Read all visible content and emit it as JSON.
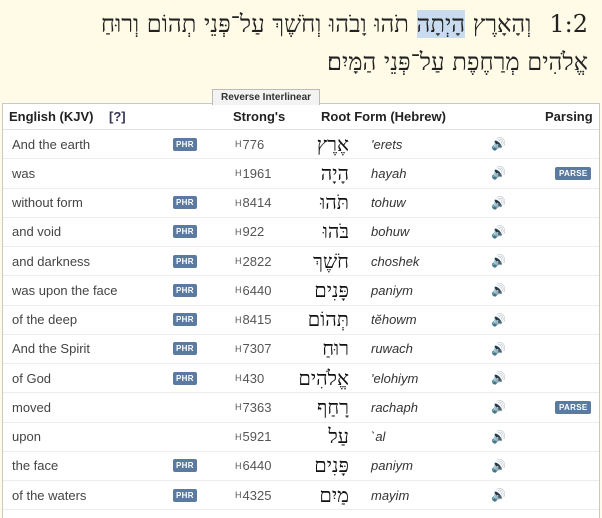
{
  "verse": {
    "reference": "1:2",
    "line1_before": "וְהָאָרֶץ ",
    "line1_highlight": "הָיְתָה",
    "line1_after": " תֹהוּ וָבֹהוּ וְחֹשֶׁךְ עַל־פְּנֵי תְהוֹם וְרוּחַ",
    "line2": "אֱלֹהִים מְרַחֶפֶת עַל־פְּנֵי הַמָּיִם׃"
  },
  "tab_label": "Reverse Interlinear",
  "header": {
    "english": "English (KJV)",
    "help": "[?]",
    "strongs": "Strong's",
    "root": "Root Form (Hebrew)",
    "parsing": "Parsing"
  },
  "badges": {
    "phrase": "PHR",
    "parse": "PARSE"
  },
  "speaker_icon_glyph": "🔊",
  "rows": [
    {
      "english": "And the earth",
      "phr": true,
      "strongs_prefix": "H",
      "strongs_num": "776",
      "hebrew": "אֶרֶץ",
      "translit": "'erets",
      "parse": false
    },
    {
      "english": "was",
      "phr": false,
      "strongs_prefix": "H",
      "strongs_num": "1961",
      "hebrew": "הָיָה",
      "translit": "hayah",
      "parse": true
    },
    {
      "english": "without form",
      "phr": true,
      "strongs_prefix": "H",
      "strongs_num": "8414",
      "hebrew": "תֹּהוּ",
      "translit": "tohuw",
      "parse": false
    },
    {
      "english": "and void",
      "phr": true,
      "strongs_prefix": "H",
      "strongs_num": "922",
      "hebrew": "בֹּהוּ",
      "translit": "bohuw",
      "parse": false
    },
    {
      "english": "and darkness",
      "phr": true,
      "strongs_prefix": "H",
      "strongs_num": "2822",
      "hebrew": "חֹשֶׁךְ",
      "translit": "choshek",
      "parse": false
    },
    {
      "english": "was upon the face",
      "phr": true,
      "strongs_prefix": "H",
      "strongs_num": "6440",
      "hebrew": "פָּנִים",
      "translit": "paniym",
      "parse": false
    },
    {
      "english": "of the deep",
      "phr": true,
      "strongs_prefix": "H",
      "strongs_num": "8415",
      "hebrew": "תְּהוֹם",
      "translit": "tĕhowm",
      "parse": false
    },
    {
      "english": "And the Spirit",
      "phr": true,
      "strongs_prefix": "H",
      "strongs_num": "7307",
      "hebrew": "רוּחַ",
      "translit": "ruwach",
      "parse": false
    },
    {
      "english": "of God",
      "phr": true,
      "strongs_prefix": "H",
      "strongs_num": "430",
      "hebrew": "אֱלֹהִים",
      "translit": "'elohiym",
      "parse": false
    },
    {
      "english": "moved",
      "phr": false,
      "strongs_prefix": "H",
      "strongs_num": "7363",
      "hebrew": "רָחַף",
      "translit": "rachaph",
      "parse": true
    },
    {
      "english": "upon",
      "phr": false,
      "strongs_prefix": "H",
      "strongs_num": "5921",
      "hebrew": "עַל",
      "translit": "`al",
      "parse": false
    },
    {
      "english": "the face",
      "phr": true,
      "strongs_prefix": "H",
      "strongs_num": "6440",
      "hebrew": "פָּנִים",
      "translit": "paniym",
      "parse": false
    },
    {
      "english": "of the waters",
      "phr": true,
      "strongs_prefix": "H",
      "strongs_num": "4325",
      "hebrew": "מַיִם",
      "translit": "mayim",
      "parse": false
    }
  ]
}
